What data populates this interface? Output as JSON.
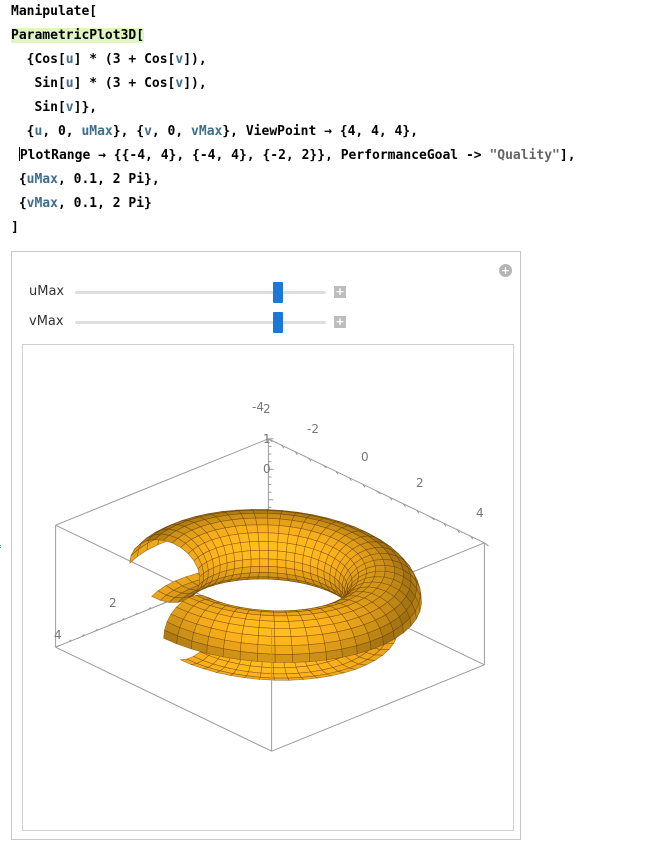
{
  "code": {
    "l1": "Manipulate[",
    "l2_fn": "ParametricPlot3D",
    "l2_br": "[",
    "l3a": "  {Cos[",
    "l3u": "u",
    "l3b": "] * (3 + Cos[",
    "l3v": "v",
    "l3c": "]),",
    "l4a": "   Sin[",
    "l4u": "u",
    "l4b": "] * (3 + Cos[",
    "l4v": "v",
    "l4c": "]),",
    "l5a": "   Sin[",
    "l5v": "v",
    "l5c": "]},",
    "l6a": "  {",
    "l6u": "u",
    "l6b": ", 0, ",
    "l6umax": "uMax",
    "l6c": "}, {",
    "l6v": "v",
    "l6d": ", 0, ",
    "l6vmax": "vMax",
    "l6e": "}, ViewPoint → {4, 4, 4},",
    "l7pre": " ",
    "l7a": "PlotRange → {{-4, 4}, {-4, 4}, {-2, 2}}, PerformanceGoal -> ",
    "l7str": "\"Quality\"",
    "l7c": "],",
    "l8a": " {",
    "l8var": "uMax",
    "l8b": ", 0.1, 2 Pi},",
    "l9a": " {",
    "l9var": "vMax",
    "l9b": ", 0.1, 2 Pi}",
    "l10": "]"
  },
  "controls": [
    {
      "label": "uMax",
      "min": 0.1,
      "max": 6.283,
      "value": 5.1
    },
    {
      "label": "vMax",
      "min": 0.1,
      "max": 6.283,
      "value": 5.1
    }
  ],
  "plot": {
    "u_max": 5.1,
    "v_max": 5.1,
    "surface_color": "#f7a51d",
    "mesh_color": "#5a3200",
    "ticks_top": [
      "-4",
      "-2",
      "0",
      "2",
      "4"
    ],
    "ticks_z": [
      "2",
      "1",
      "0"
    ],
    "ticks_left": [
      "2",
      "4"
    ]
  }
}
